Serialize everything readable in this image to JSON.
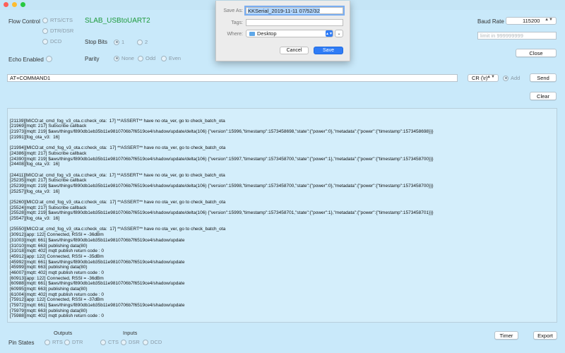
{
  "window": {
    "device_name": "SLAB_USBtoUART2"
  },
  "flow_control": {
    "label": "Flow Control",
    "options": [
      "RTS/CTS",
      "DTR/DSR",
      "DCD"
    ]
  },
  "stop_bits": {
    "label": "Stop Bits",
    "options": [
      "1",
      "2"
    ],
    "selected": "1"
  },
  "echo": {
    "label": "Echo Enabled"
  },
  "parity": {
    "label": "Parity",
    "options": [
      "None",
      "Odd",
      "Even"
    ],
    "selected": "None"
  },
  "baud": {
    "label": "Baud Rate",
    "value": "115200"
  },
  "limit": {
    "placeholder": "limit in 999999999"
  },
  "buttons": {
    "close": "Close",
    "send": "Send",
    "clear": "Clear",
    "timer": "Timer",
    "export": "Export"
  },
  "command": {
    "value": "AT+COMMAND1"
  },
  "line_ending": {
    "value": "CR (\\r)"
  },
  "add": {
    "label": "Add"
  },
  "pin_states": {
    "label": "Pin States",
    "outputs_label": "Outputs",
    "inputs_label": "Inputs",
    "outputs": [
      "RTS",
      "DTR"
    ],
    "inputs": [
      "CTS",
      "DSR",
      "DCD"
    ]
  },
  "save_dialog": {
    "save_as_label": "Save As:",
    "save_as_value": "KKSerial_2019-11-11 07/52/32",
    "tags_label": "Tags:",
    "where_label": "Where:",
    "where_value": "Desktop",
    "cancel": "Cancel",
    "save": "Save"
  },
  "log_lines": [
    "",
    "[21139][MICO:at_cmd_fog_v3_ota.c:check_ota:  17] **ASSERT** have no ota_ver, go to check_batch_ota",
    "[21969][mqtt: 217] Subscribe callback",
    "[21973][mqtt: 219] $aws/things/f890db1eb35b11e9810706b7f6519ce4/shadow/update/delta(106) {\"version\":15996,\"timestamp\":1573458698,\"state\":{\"power\":0},\"metadata\":{\"power\":{\"timestamp\":1573458698}}}",
    "[21991][fog_ota_v3:  16]",
    "",
    "[21994][MICO:at_cmd_fog_v3_ota.c:check_ota:  17] **ASSERT** have no ota_ver, go to check_batch_ota",
    "[24386][mqtt: 217] Subscribe callback",
    "[24390][mqtt: 219] $aws/things/f890db1eb35b11e9810706b7f6519ce4/shadow/update/delta(106) {\"version\":15997,\"timestamp\":1573458700,\"state\":{\"power\":1},\"metadata\":{\"power\":{\"timestamp\":1573458700}}}",
    "[24408][fog_ota_v3:  16]",
    "",
    "[24411][MICO:at_cmd_fog_v3_ota.c:check_ota:  17] **ASSERT** have no ota_ver, go to check_batch_ota",
    "[25235][mqtt: 217] Subscribe callback",
    "[25239][mqtt: 219] $aws/things/f890db1eb35b11e9810706b7f6519ce4/shadow/update/delta(106) {\"version\":15998,\"timestamp\":1573458700,\"state\":{\"power\":0},\"metadata\":{\"power\":{\"timestamp\":1573458700}}}",
    "[25257][fog_ota_v3:  16]",
    "",
    "[25260][MICO:at_cmd_fog_v3_ota.c:check_ota:  17] **ASSERT** have no ota_ver, go to check_batch_ota",
    "[25524][mqtt: 217] Subscribe callback",
    "[25528][mqtt: 219] $aws/things/f890db1eb35b11e9810706b7f6519ce4/shadow/update/delta(106) {\"version\":15999,\"timestamp\":1573458701,\"state\":{\"power\":1},\"metadata\":{\"power\":{\"timestamp\":1573458701}}}",
    "[25547][fog_ota_v3:  16]",
    "",
    "[25550][MICO:at_cmd_fog_v3_ota.c:check_ota:  17] **ASSERT** have no ota_ver, go to check_batch_ota",
    "[30912][app: 122] Connected, RSSI = -36dBm",
    "[31003][mqtt: 661] $aws/things/f890db1eb35b11e9810706b7f6519ce4/shadow/update",
    "[31010][mqtt: 663] publishing data(80)",
    "[31018][mqtt: 402] mqtt publish return code : 0",
    "[45912][app: 122] Connected, RSSI = -35dBm",
    "[45992][mqtt: 661] $aws/things/f890db1eb35b11e9810706b7f6519ce4/shadow/update",
    "[45999][mqtt: 663] publishing data(80)",
    "[46007][mqtt: 402] mqtt publish return code : 0",
    "[60913][app: 122] Connected, RSSI = -36dBm",
    "[60988][mqtt: 661] $aws/things/f890db1eb35b11e9810706b7f6519ce4/shadow/update",
    "[60995][mqtt: 663] publishing data(80)",
    "[61004][mqtt: 402] mqtt publish return code : 0",
    "[75912][app: 122] Connected, RSSI = -37dBm",
    "[75972][mqtt: 661] $aws/things/f890db1eb35b11e9810706b7f6519ce4/shadow/update",
    "[75979][mqtt: 663] publishing data(80)",
    "[75988][mqtt: 402] mqtt publish return code : 0"
  ],
  "colors": {
    "device_name": "#1e9a3c",
    "background": "#c9e9fa",
    "save_button": "#2f7cf6"
  }
}
